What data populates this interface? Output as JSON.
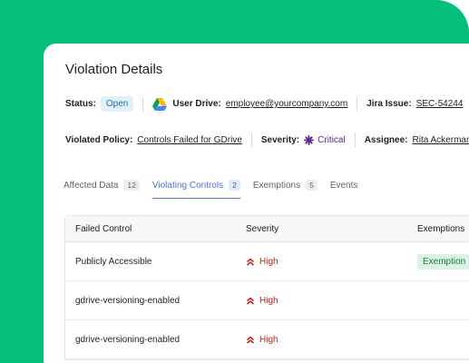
{
  "page": {
    "title": "Violation Details"
  },
  "meta": {
    "status_label": "Status:",
    "status_value": "Open",
    "drive_label": "User Drive:",
    "drive_value": "employee@yourcompany.com",
    "jira_label": "Jira Issue:",
    "jira_value": "SEC-54244",
    "policy_label": "Violated Policy:",
    "policy_value": "Controls Failed for GDrive",
    "severity_label": "Severity:",
    "severity_value": "Critical",
    "assignee_label": "Assignee:",
    "assignee_value": "Rita Ackerman"
  },
  "tabs": [
    {
      "label": "Affected Data",
      "count": "12"
    },
    {
      "label": "Violating Controls",
      "count": "2"
    },
    {
      "label": "Exemptions",
      "count": "5"
    },
    {
      "label": "Events",
      "count": ""
    }
  ],
  "table": {
    "headers": [
      "Failed Control",
      "Severity",
      "Exemptions"
    ],
    "rows": [
      {
        "control": "Publicly Accessible",
        "severity": "High",
        "exemption": "Exemption"
      },
      {
        "control": "gdrive-versioning-enabled",
        "severity": "High",
        "exemption": ""
      },
      {
        "control": "gdrive-versioning-enabled",
        "severity": "High",
        "exemption": ""
      }
    ]
  },
  "colors": {
    "brand_green": "#05bf7a",
    "accent_blue": "#4a74d9",
    "high_red": "#b3261e",
    "critical_purple": "#5b2a86"
  },
  "icons": {
    "drive": "google-drive-icon",
    "severity_critical": "critical-star-icon",
    "severity_high": "double-chevron-up-icon"
  }
}
